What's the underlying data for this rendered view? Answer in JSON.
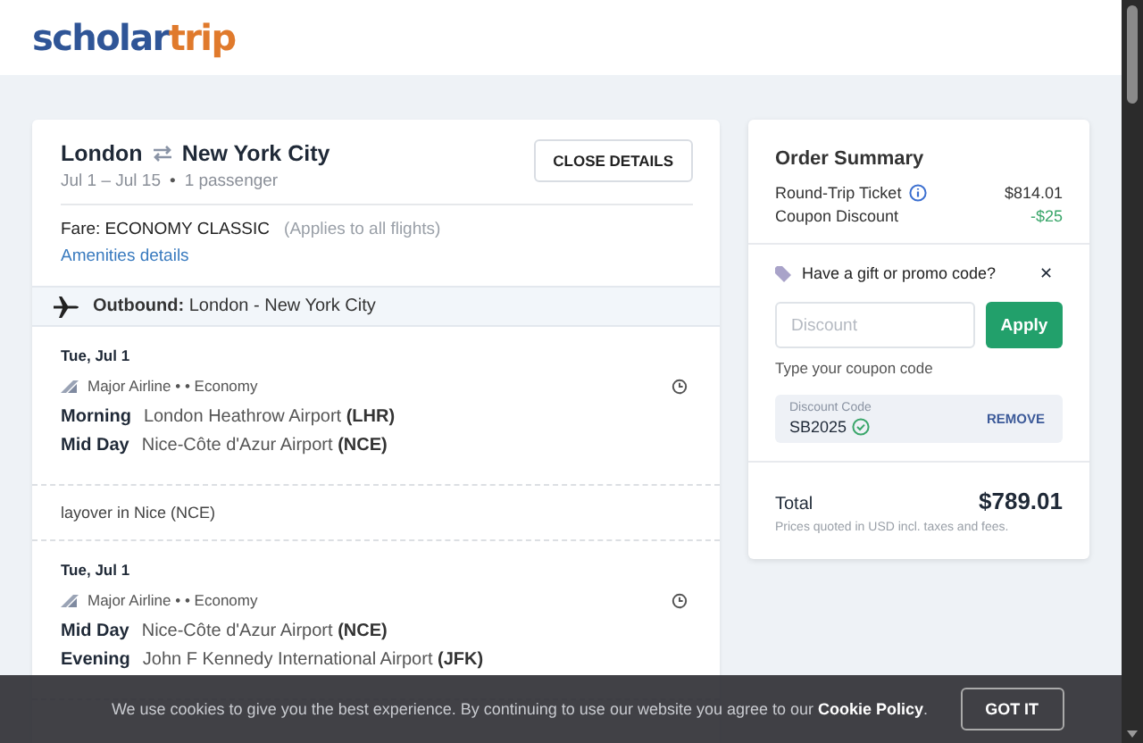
{
  "header": {
    "logo": {
      "part_1": "scholar",
      "part_2": "trip"
    }
  },
  "trip": {
    "origin": "London",
    "destination": "New York City",
    "dates": "Jul 1  –  Jul 15",
    "separator": "•",
    "passengers": "1 passenger",
    "close_button": "CLOSE DETAILS",
    "fare": "Fare: ECONOMY CLASSIC",
    "fare_note": "(Applies to all flights)",
    "amenities_link": "Amenities details",
    "outbound": "**Outbound:** London - New York City"
  },
  "segments": [
    {
      "kind": "flight",
      "date": "Tue, Jul 1",
      "airline": "Major Airline •  • Economy",
      "stops": [
        {
          "time": "Morning",
          "airport": "London Heathrow Airport **(LHR)**"
        },
        {
          "time": "Mid Day",
          "airport": "Nice-Côte d'Azur Airport **(NCE)**"
        }
      ]
    },
    {
      "kind": "layover",
      "text": "layover in Nice (NCE)"
    },
    {
      "kind": "flight",
      "date": "Tue, Jul 1",
      "airline": "Major Airline •  • Economy",
      "stops": [
        {
          "time": "Mid Day",
          "airport": "Nice-Côte d'Azur Airport **(NCE)**"
        },
        {
          "time": "Evening",
          "airport": "John F Kennedy International Airport **(JFK)**"
        }
      ]
    }
  ],
  "summary": {
    "title": "Order Summary",
    "lines": [
      {
        "kind": "price",
        "label": "Round-Trip Ticket",
        "value": "$814.01",
        "info": true
      },
      {
        "kind": "discount",
        "label": "Coupon Discount",
        "value": "-$25",
        "info": false
      }
    ],
    "promo": {
      "title": "Have a gift or promo code?",
      "close": "✕",
      "placeholder": "Discount",
      "apply": "Apply",
      "hint": "Type your coupon code",
      "code_label": "Discount Code",
      "code": "SB2025",
      "remove": "REMOVE"
    },
    "total_label": "Total",
    "total": "$789.01",
    "note": "Prices quoted in USD incl. taxes and fees."
  },
  "cookie": {
    "text": "We use cookies to give you the best experience. By continuing to use our website you agree to our **Cookie Policy**.",
    "button": "GOT IT"
  }
}
